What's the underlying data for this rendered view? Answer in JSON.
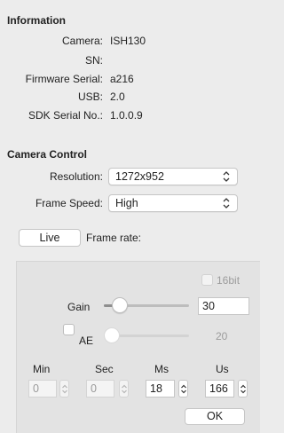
{
  "information": {
    "title": "Information",
    "rows": [
      {
        "label": "Camera:",
        "value": "ISH130"
      },
      {
        "label": "SN:",
        "value": ""
      },
      {
        "label": "Firmware Serial:",
        "value": "a216"
      },
      {
        "label": "USB:",
        "value": "2.0"
      },
      {
        "label": "SDK Serial No.:",
        "value": "1.0.0.9"
      }
    ]
  },
  "camera_control": {
    "title": "Camera Control",
    "resolution_label": "Resolution:",
    "resolution_value": "1272x952",
    "frame_speed_label": "Frame Speed:",
    "frame_speed_value": "High",
    "live_button": "Live",
    "frame_rate_label": "Frame rate:"
  },
  "exposure_panel": {
    "bit16_label": "16bit",
    "gain_label": "Gain",
    "gain_value": "30",
    "gain_slider_fraction": 0.12,
    "ae_label": "AE",
    "ae_value": "20",
    "ae_slider_fraction": 0.0,
    "columns": [
      "Min",
      "Sec",
      "Ms",
      "Us"
    ],
    "values": [
      "0",
      "0",
      "18",
      "166"
    ],
    "ok_button": "OK"
  },
  "icons": {
    "chevron": "up-down-chevron-icon",
    "stepper": "stepper-arrows-icon"
  }
}
